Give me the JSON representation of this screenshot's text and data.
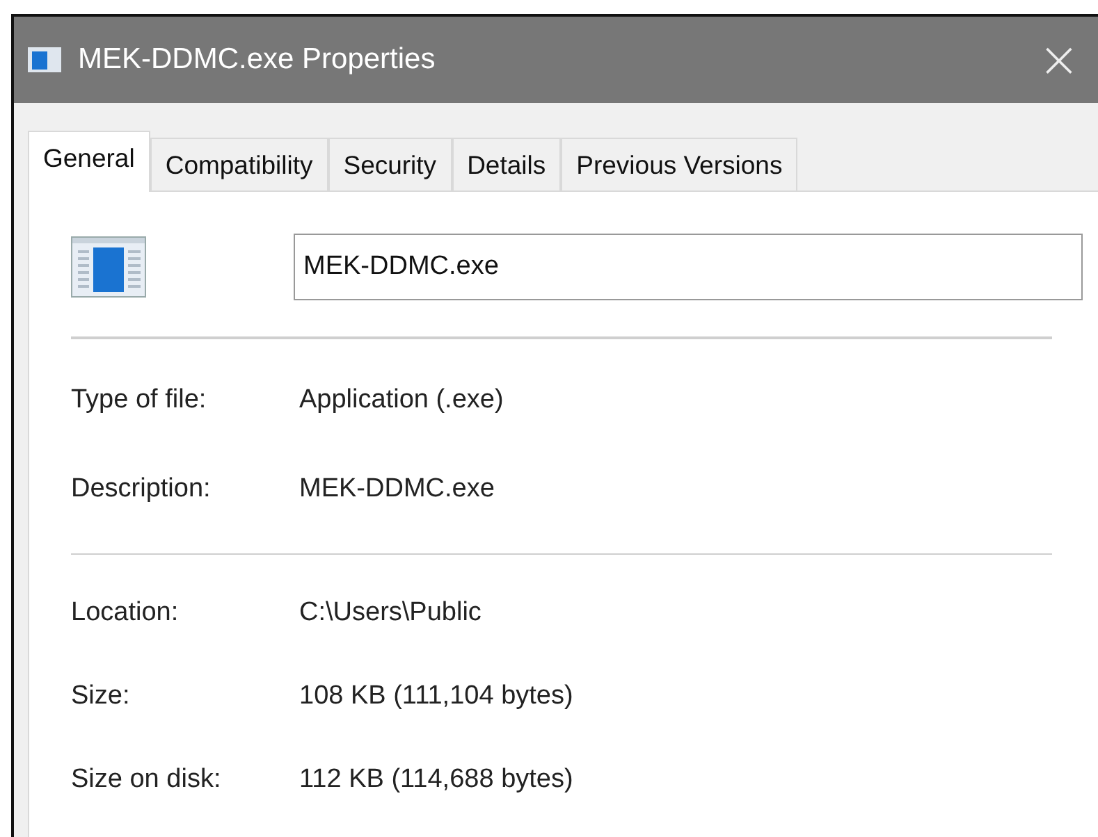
{
  "window": {
    "title": "MEK-DDMC.exe Properties",
    "close_button": "×"
  },
  "tabs": [
    {
      "label": "General",
      "selected": true
    },
    {
      "label": "Compatibility",
      "selected": false
    },
    {
      "label": "Security",
      "selected": false
    },
    {
      "label": "Details",
      "selected": false
    },
    {
      "label": "Previous Versions",
      "selected": false
    }
  ],
  "file_name_field": {
    "value": "MEK-DDMC.exe"
  },
  "property_groups": [
    {
      "rows": [
        {
          "label": "Type of file:",
          "value": "Application (.exe)"
        },
        {
          "label": "Description:",
          "value": "MEK-DDMC.exe"
        }
      ]
    },
    {
      "rows": [
        {
          "label": "Location:",
          "value": "C:\\Users\\Public"
        },
        {
          "label": "Size:",
          "value": "108 KB (111,104 bytes)"
        },
        {
          "label": "Size on disk:",
          "value": "112 KB (114,688 bytes)"
        }
      ]
    }
  ]
}
